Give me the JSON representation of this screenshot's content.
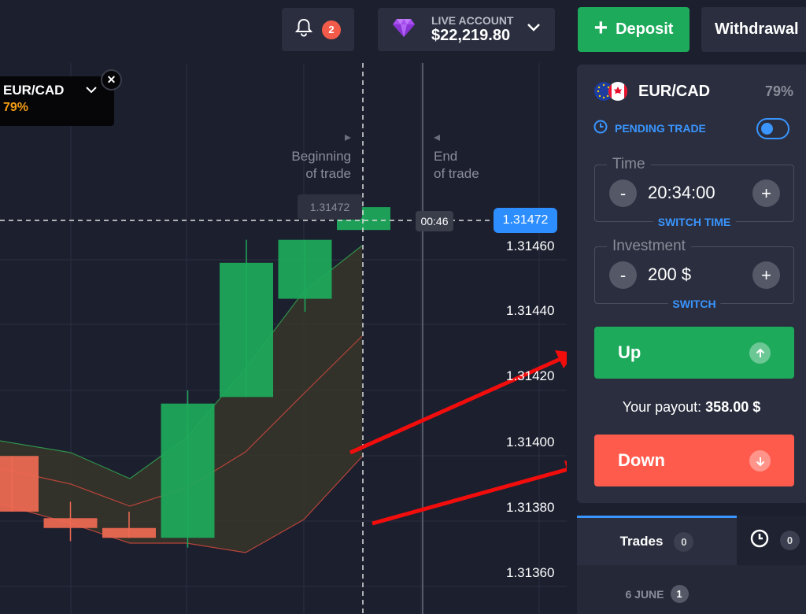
{
  "header": {
    "notifications_count": "2",
    "account_label": "LIVE ACCOUNT",
    "account_balance": "$22,219.80",
    "deposit_label": "Deposit",
    "withdrawal_label": "Withdrawal"
  },
  "chart_overlay": {
    "asset_tag_name": "EUR/CAD",
    "asset_tag_pct": "79%",
    "beginning_line1": "Beginning",
    "beginning_line2": "of trade",
    "end_line1": "End",
    "end_line2": "of trade",
    "entry_price": "1.31472",
    "timer": "00:46",
    "current_price": "1.31472"
  },
  "chart_data": {
    "type": "candlestick",
    "y_ticks": [
      "1.31460",
      "1.31440",
      "1.31420",
      "1.31400",
      "1.31380",
      "1.31360"
    ],
    "candles": [
      {
        "open": 1.31396,
        "close": 1.31379,
        "high": 1.31396,
        "low": 1.31379,
        "color": "red"
      },
      {
        "open": 1.31377,
        "close": 1.31374,
        "high": 1.31382,
        "low": 1.3137,
        "color": "red"
      },
      {
        "open": 1.31374,
        "close": 1.31371,
        "high": 1.31379,
        "low": 1.31371,
        "color": "red"
      },
      {
        "open": 1.31371,
        "close": 1.31412,
        "high": 1.31416,
        "low": 1.31368,
        "color": "green"
      },
      {
        "open": 1.31414,
        "close": 1.31455,
        "high": 1.31462,
        "low": 1.31414,
        "color": "green"
      },
      {
        "open": 1.31444,
        "close": 1.31462,
        "high": 1.31462,
        "low": 1.3144,
        "color": "green"
      },
      {
        "open": 1.31465,
        "close": 1.31472,
        "high": 1.31472,
        "low": 1.31465,
        "color": "green"
      }
    ],
    "current_price": 1.31472
  },
  "panel": {
    "asset_name": "EUR/CAD",
    "asset_payout_pct": "79%",
    "pending_trade_label": "PENDING TRADE",
    "time_legend": "Time",
    "time_value": "20:34:00",
    "switch_time_label": "SWITCH TIME",
    "investment_legend": "Investment",
    "investment_value": "200 $",
    "switch_label": "SWITCH",
    "minus_symbol": "-",
    "plus_symbol": "+",
    "up_label": "Up",
    "down_label": "Down",
    "payout_label": "Your payout:",
    "payout_value": "358.00 $"
  },
  "tabs": {
    "trades_label": "Trades",
    "trades_count": "0",
    "history_count": "0",
    "date_label": "6 JUNE",
    "date_count": "1"
  },
  "colors": {
    "background": "#1c1f2e",
    "panel": "#2a2e3e",
    "green": "#1daa5b",
    "red": "#ff5b4d",
    "blue": "#2d8eff",
    "orange": "#f39c12"
  }
}
